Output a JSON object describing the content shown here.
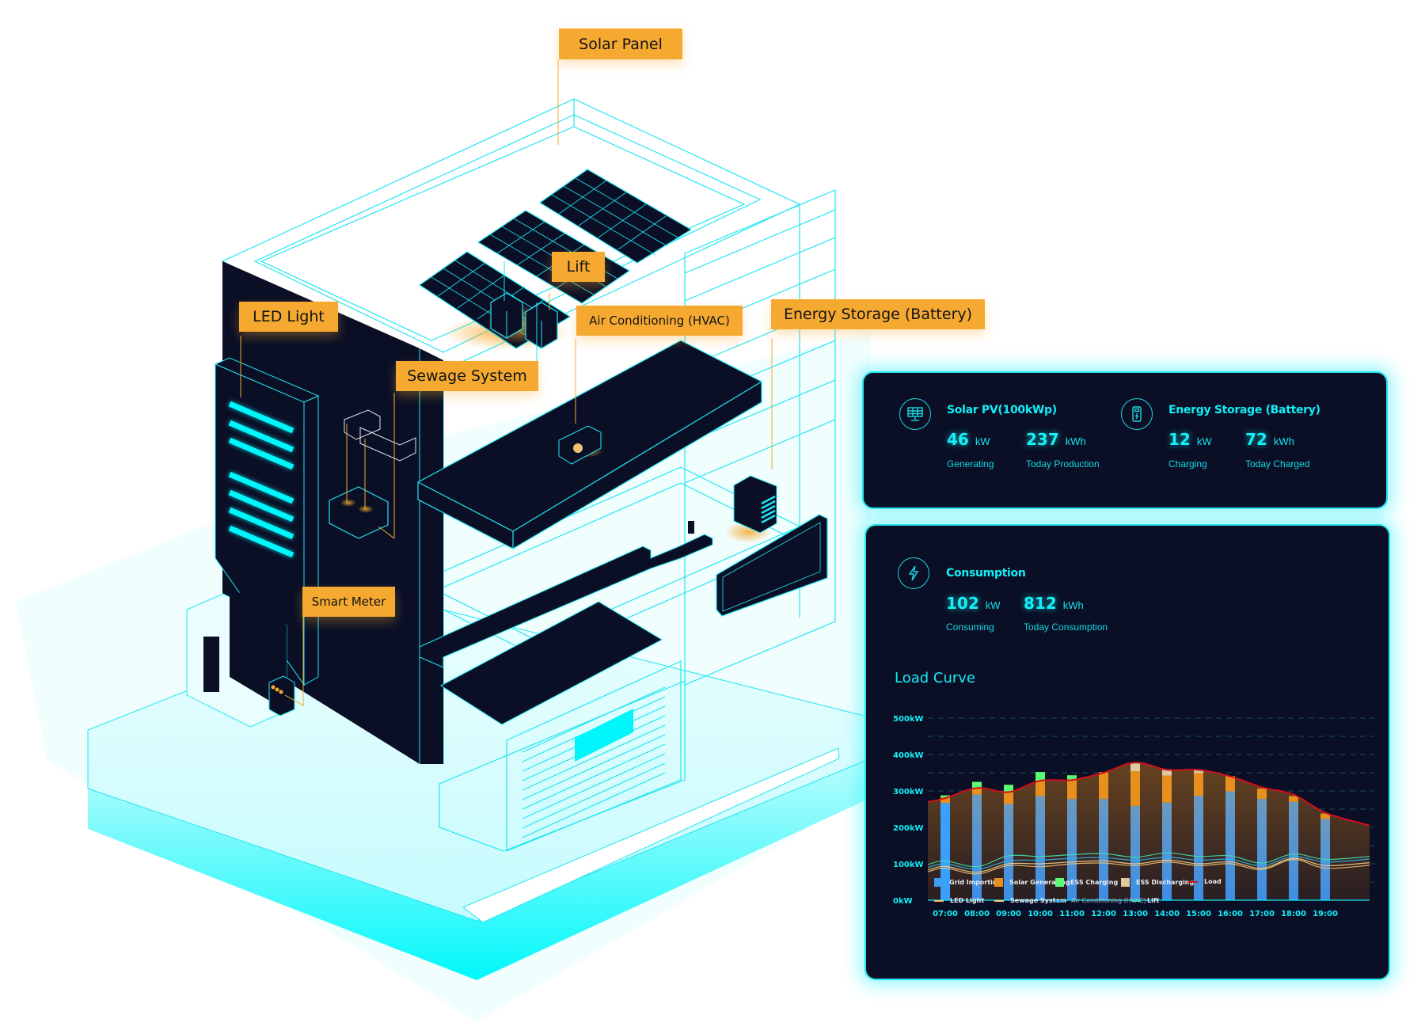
{
  "scene": {
    "labels": {
      "solar_panel": "Solar Panel",
      "lift": "Lift",
      "led_light": "LED Light",
      "air_conditioning": "Air Conditioning (HVAC)",
      "energy_storage": "Energy Storage (Battery)",
      "sewage_system": "Sewage System",
      "smart_meter": "Smart Meter"
    },
    "colors": {
      "label_bg": "#f6a930",
      "outline": "#22e6f0",
      "dark_face": "#0a0f26",
      "glow": "#f6a930"
    }
  },
  "summary_panel": {
    "solar": {
      "icon": "solar-panel-icon",
      "title": "Solar PV(100kWp)",
      "power_value": "46",
      "power_unit": "kW",
      "power_caption": "Generating",
      "energy_value": "237",
      "energy_unit": "kWh",
      "energy_caption": "Today Production"
    },
    "storage": {
      "icon": "battery-icon",
      "title": "Energy Storage (Battery)",
      "power_value": "12",
      "power_unit": "kW",
      "power_caption": "Charging",
      "energy_value": "72",
      "energy_unit": "kWh",
      "energy_caption": "Today Charged"
    }
  },
  "consumption_panel": {
    "icon": "lightning-icon",
    "title": "Consumption",
    "power_value": "102",
    "power_unit": "kW",
    "power_caption": "Consuming",
    "energy_value": "812",
    "energy_unit": "kWh",
    "energy_caption": "Today Consumption",
    "chart_title": "Load Curve"
  },
  "chart_data": {
    "type": "bar",
    "title": "Load Curve",
    "xlabel": "",
    "ylabel": "",
    "ylim": [
      0,
      500
    ],
    "y_ticks": [
      0,
      100,
      200,
      300,
      400,
      500
    ],
    "y_tick_labels": [
      "0kW",
      "100kW",
      "200kW",
      "300kW",
      "400kW",
      "500kW"
    ],
    "grid": true,
    "stacked": true,
    "categories": [
      "07:00",
      "08:00",
      "09:00",
      "10:00",
      "11:00",
      "12:00",
      "13:00",
      "14:00",
      "15:00",
      "16:00",
      "17:00",
      "18:00",
      "19:00"
    ],
    "series": [
      {
        "name": "Grid Importing",
        "kind": "bar",
        "color": "#3d9ff0",
        "values": [
          267,
          290,
          264,
          286,
          278,
          278,
          259,
          268,
          287,
          299,
          278,
          270,
          223
        ]
      },
      {
        "name": "Solar Generating",
        "kind": "bar",
        "color": "#e8901e",
        "values": [
          16,
          17,
          32,
          42,
          53,
          74,
          95,
          74,
          62,
          42,
          29,
          16,
          15
        ]
      },
      {
        "name": "ESS Charging",
        "kind": "bar",
        "color": "#5cfb74",
        "values": [
          5,
          18,
          21,
          24,
          12,
          0,
          0,
          0,
          0,
          0,
          0,
          0,
          0
        ]
      },
      {
        "name": "ESS Discharging",
        "kind": "bar",
        "color": "#dfc79e",
        "values": [
          0,
          0,
          0,
          0,
          0,
          0,
          24,
          18,
          10,
          0,
          0,
          0,
          0
        ]
      },
      {
        "name": "Load",
        "kind": "line",
        "color": "#d0101a",
        "values": [
          280,
          308,
          297,
          328,
          330,
          350,
          378,
          358,
          358,
          340,
          310,
          290,
          240
        ]
      },
      {
        "name": "LED Light",
        "kind": "line",
        "color": "#f0c070",
        "values": [
          88,
          72,
          95,
          92,
          100,
          102,
          95,
          105,
          95,
          100,
          84,
          112,
          88
        ]
      },
      {
        "name": "Sewage System",
        "kind": "line",
        "color": "#f5d088",
        "values": [
          93,
          77,
          100,
          100,
          105,
          108,
          100,
          110,
          100,
          105,
          88,
          115,
          95
        ]
      },
      {
        "name": "Air Conditioning (HVAC)",
        "kind": "line",
        "color": "#2fb4e8",
        "values": [
          100,
          85,
          108,
          110,
          115,
          117,
          110,
          118,
          110,
          112,
          95,
          120,
          105
        ]
      },
      {
        "name": "Lift",
        "kind": "line",
        "color": "#3ee0b0",
        "values": [
          108,
          92,
          122,
          120,
          125,
          128,
          118,
          130,
          120,
          122,
          102,
          127,
          112
        ]
      }
    ],
    "legend": [
      "Grid Importing",
      "Solar Generating",
      "ESS Charging",
      "ESS Discharging",
      "Load",
      "LED Light",
      "Sewage System",
      "Air Conditioning (HVAC)",
      "Lift"
    ],
    "legend_position": "bottom"
  }
}
